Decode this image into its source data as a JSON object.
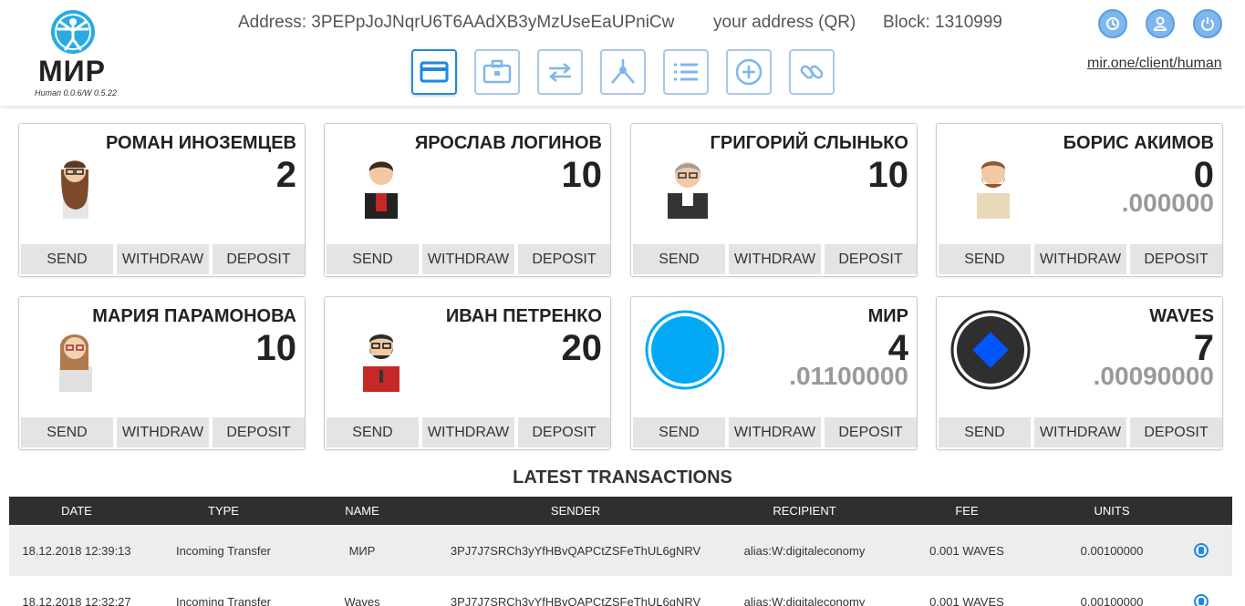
{
  "app": {
    "logo_text": "МИР",
    "version": "Human 0.0.6/W 0.5.22",
    "address": "Address: 3PEPpJoJNqrU6T6AAdXB3yMzUseEaUPniCw",
    "qr_label": "your address (QR)",
    "block": "Block: 1310999",
    "client_link": "mir.one/client/human"
  },
  "nav": [
    {
      "icon": "wallet-card-icon",
      "active": true
    },
    {
      "icon": "briefcase-icon",
      "active": false
    },
    {
      "icon": "exchange-arrows-icon",
      "active": false
    },
    {
      "icon": "network-tree-icon",
      "active": false
    },
    {
      "icon": "list-icon",
      "active": false
    },
    {
      "icon": "plus-circle-icon",
      "active": false
    },
    {
      "icon": "link-icon",
      "active": false
    }
  ],
  "top_icons": [
    "history-icon",
    "user-icon",
    "power-icon"
  ],
  "card_actions": {
    "send": "SEND",
    "withdraw": "WITHDRAW",
    "deposit": "DEPOSIT"
  },
  "cards": [
    {
      "name": "РОМАН ИНОЗЕМЦЕВ",
      "amount": "2",
      "fraction": ""
    },
    {
      "name": "ЯРОСЛАВ ЛОГИНОВ",
      "amount": "10",
      "fraction": ""
    },
    {
      "name": "ГРИГОРИЙ СЛЫНЬКО",
      "amount": "10",
      "fraction": ""
    },
    {
      "name": "БОРИС АКИМОВ",
      "amount": "0",
      "fraction": ".000000"
    },
    {
      "name": "МАРИЯ ПАРАМОНОВА",
      "amount": "10",
      "fraction": ""
    },
    {
      "name": "ИВАН ПЕТРЕНКО",
      "amount": "20",
      "fraction": ""
    },
    {
      "name": "МИР",
      "amount": "4",
      "fraction": ".01100000"
    },
    {
      "name": "WAVES",
      "amount": "7",
      "fraction": ".00090000"
    }
  ],
  "transactions": {
    "title": "LATEST TRANSACTIONS",
    "columns": [
      "DATE",
      "TYPE",
      "NAME",
      "SENDER",
      "RECIPIENT",
      "FEE",
      "UNITS"
    ],
    "rows": [
      {
        "date": "18.12.2018 12:39:13",
        "type": "Incoming Transfer",
        "name": "МИР",
        "sender": "3PJ7J7SRCh3yYfHBvQAPCtZSFeThUL6gNRV",
        "recipient": "alias:W:digitaleconomy",
        "fee": "0.001 WAVES",
        "units": "0.00100000"
      },
      {
        "date": "18.12.2018 12:32:27",
        "type": "Incoming Transfer",
        "name": "Waves",
        "sender": "3PJ7J7SRCh3yYfHBvQAPCtZSFeThUL6gNRV",
        "recipient": "alias:W:digitaleconomy",
        "fee": "0.001 WAVES",
        "units": "0.00100000"
      }
    ]
  },
  "colors": {
    "accent": "#1e88e5",
    "nav_border": "#a9c8ea",
    "coin_mir": "#03a9f4",
    "coin_waves": "#0055ff",
    "table_header": "#2f2f2f"
  }
}
